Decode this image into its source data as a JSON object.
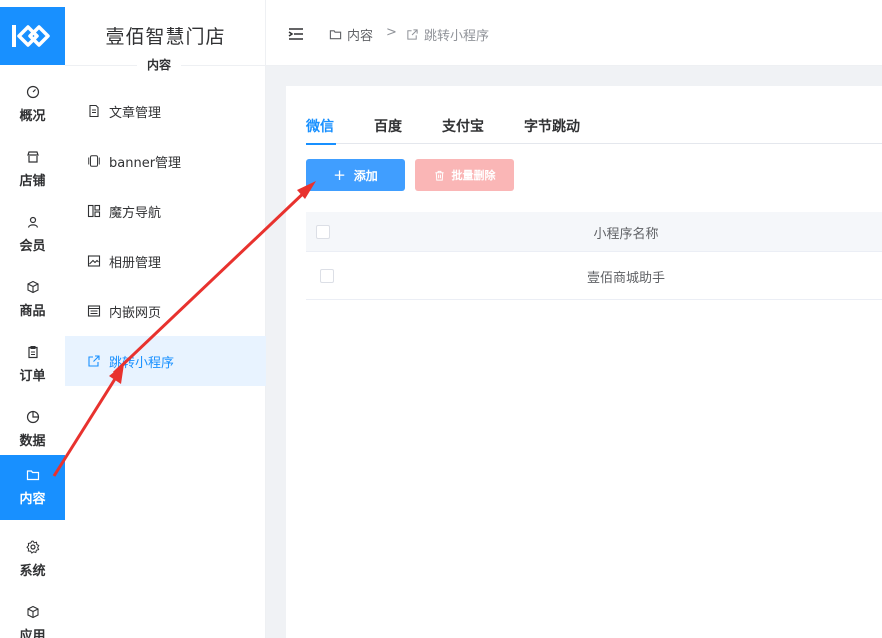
{
  "brand": {
    "color": "#1890ff",
    "danger_light": "#fab6b6"
  },
  "rail": {
    "items": [
      {
        "label": "概况",
        "icon": "gauge-icon"
      },
      {
        "label": "店铺",
        "icon": "shop-icon"
      },
      {
        "label": "会员",
        "icon": "user-icon"
      },
      {
        "label": "商品",
        "icon": "box-icon"
      },
      {
        "label": "订单",
        "icon": "clipboard-icon"
      },
      {
        "label": "数据",
        "icon": "pie-chart-icon"
      },
      {
        "label": "内容",
        "icon": "folder-icon",
        "active": true
      },
      {
        "label": "系统",
        "icon": "gear-icon"
      },
      {
        "label": "应用",
        "icon": "cube-icon"
      }
    ]
  },
  "submenu": {
    "store_name": "壹佰智慧门店",
    "section_label": "内容",
    "items": [
      {
        "label": "文章管理",
        "icon": "document-icon"
      },
      {
        "label": "banner管理",
        "icon": "carousel-icon"
      },
      {
        "label": "魔方导航",
        "icon": "layout-icon"
      },
      {
        "label": "相册管理",
        "icon": "image-icon"
      },
      {
        "label": "内嵌网页",
        "icon": "browser-icon"
      },
      {
        "label": "跳转小程序",
        "icon": "external-link-icon",
        "active": true
      }
    ]
  },
  "header": {
    "breadcrumb": [
      {
        "label": "内容",
        "icon": "folder-icon"
      },
      {
        "label": "跳转小程序",
        "icon": "external-link-icon"
      }
    ],
    "separator": ">"
  },
  "tabs": [
    {
      "label": "微信",
      "active": true
    },
    {
      "label": "百度"
    },
    {
      "label": "支付宝"
    },
    {
      "label": "字节跳动"
    }
  ],
  "toolbar": {
    "add_label": "添加",
    "add_icon": "plus-icon",
    "batch_delete_label": "批量删除",
    "batch_delete_icon": "trash-icon"
  },
  "table": {
    "columns": [
      "小程序名称"
    ],
    "rows": [
      [
        "壹佰商城助手"
      ]
    ]
  }
}
